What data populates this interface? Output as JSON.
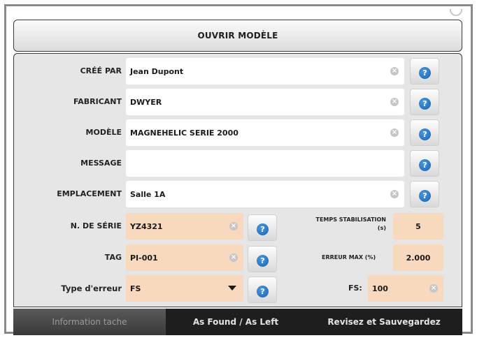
{
  "header": {
    "title": "OUVRIR MODÈLE"
  },
  "fields": {
    "cree_par": {
      "label": "CRÉÉ PAR",
      "value": "Jean Dupont"
    },
    "fabricant": {
      "label": "FABRICANT",
      "value": "DWYER"
    },
    "modele": {
      "label": "MODÈLE",
      "value": "MAGNEHELIC SERIE 2000"
    },
    "message": {
      "label": "MESSAGE",
      "value": ""
    },
    "emplacement": {
      "label": "EMPLACEMENT",
      "value": "Salle 1A"
    },
    "serie": {
      "label": "N. DE SÉRIE",
      "value": "YZ4321"
    },
    "tag": {
      "label": "TAG",
      "value": "PI-001"
    },
    "type_erreur": {
      "label": "Type d'erreur",
      "value": "FS"
    },
    "temps_stab": {
      "label_line1": "TEMPS STABILISATION",
      "label_line2": "(s)",
      "value": "5"
    },
    "erreur_max": {
      "label": "ERREUR MAX (%)",
      "value": "2.000"
    },
    "fs": {
      "label": "FS:",
      "value": "100"
    }
  },
  "icons": {
    "help": "?",
    "clear": "×",
    "help_icon_name": "help-icon",
    "clear_icon_name": "clear-icon"
  },
  "tabs": [
    {
      "label": "Information tache"
    },
    {
      "label": "As Found / As Left"
    },
    {
      "label": "Revisez et Sauvegardez"
    }
  ],
  "colors": {
    "peach_field": "#f9d9bd",
    "help_blue": "#1b5fb0",
    "tab_bar": "#1e1e1e"
  }
}
